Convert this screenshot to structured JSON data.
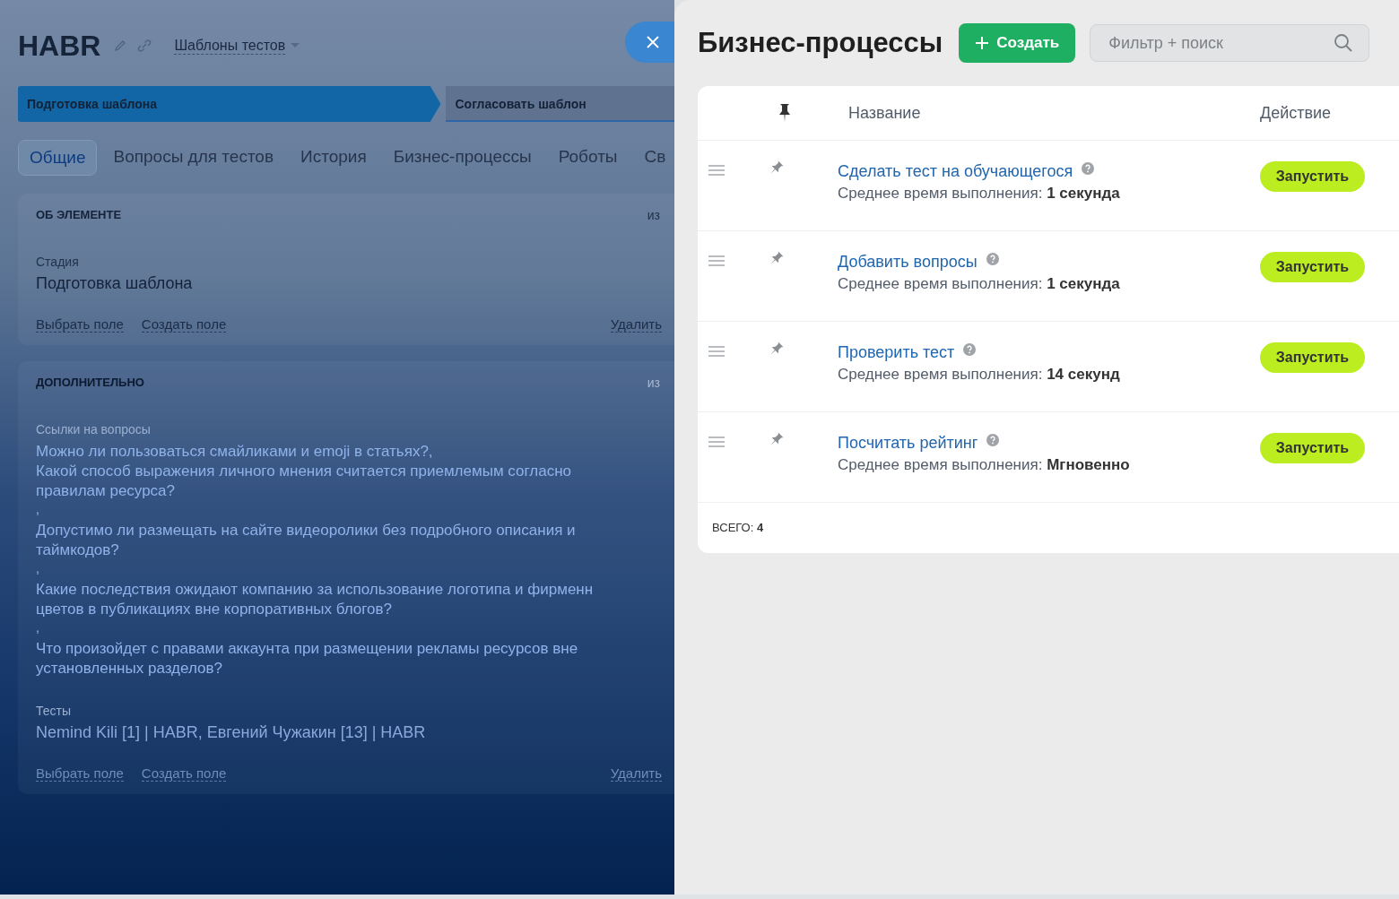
{
  "page": {
    "title": "HABR",
    "category": "Шаблоны тестов",
    "stages": [
      {
        "label": "Подготовка шаблона",
        "selected": true
      },
      {
        "label": "Согласовать шаблон",
        "selected": false
      }
    ],
    "tabs": [
      {
        "label": "Общие",
        "selected": true
      },
      {
        "label": "Вопросы для тестов",
        "selected": false
      },
      {
        "label": "История",
        "selected": false
      },
      {
        "label": "Бизнес-процессы",
        "selected": false
      },
      {
        "label": "Роботы",
        "selected": false
      },
      {
        "label": "Св",
        "selected": false
      }
    ],
    "sections": [
      {
        "title": "ОБ ЭЛЕМЕНТЕ",
        "corner": "из",
        "fields": [
          {
            "kind": "text",
            "label": "Стадия",
            "value": "Подготовка шаблона"
          }
        ],
        "actions": [
          "Выбрать поле",
          "Создать поле"
        ],
        "delete": "Удалить"
      },
      {
        "title": "ДОПОЛНИТЕЛЬНО",
        "corner": "из",
        "fields": [
          {
            "kind": "links",
            "label": "Ссылки на вопросы",
            "links": [
              {
                "lines": [
                  "Можно ли пользоваться смайликами и emoji в статьях?,"
                ]
              },
              {
                "lines": [
                  "Какой способ выражения личного мнения считается приемлемым согласно",
                  "правилам ресурса?"
                ],
                "separator": ","
              },
              {
                "lines": [
                  "Допустимо ли размещать на сайте видеоролики без подробного описания и",
                  "таймкодов?"
                ],
                "separator": ","
              },
              {
                "lines": [
                  "Какие последствия ожидают компанию за использование логотипа и фирменн",
                  "цветов в публикациях вне корпоративных блогов?"
                ],
                "separator": ","
              },
              {
                "lines": [
                  "Что произойдет с правами аккаунта при размещении рекламы ресурсов вне",
                  "установленных разделов?"
                ]
              }
            ]
          },
          {
            "kind": "text",
            "label": "Тесты",
            "value": "Nemind Kili [1] | HABR, Евгений Чужакин [13] | HABR"
          }
        ],
        "actions": [
          "Выбрать поле",
          "Создать поле"
        ],
        "delete": "Удалить"
      }
    ]
  },
  "panel": {
    "title": "Бизнес-процессы",
    "create_button": "Создать",
    "search": {
      "placeholder": "Фильтр + поиск"
    },
    "columns": [
      "Название",
      "Действие"
    ],
    "rows": [
      {
        "name": "Сделать тест на обучающегося",
        "time_label": "Среднее время выполнения:",
        "time": "1 секунда",
        "action": "Запустить"
      },
      {
        "name": "Добавить вопросы",
        "time_label": "Среднее время выполнения:",
        "time": "1 секунда",
        "action": "Запустить"
      },
      {
        "name": "Проверить тест",
        "time_label": "Среднее время выполнения:",
        "time": "14 секунд",
        "action": "Запустить"
      },
      {
        "name": "Посчитать рейтинг",
        "time_label": "Среднее время выполнения:",
        "time": "Мгновенно",
        "action": "Запустить"
      }
    ],
    "total_label": "ВСЕГО:",
    "total": "4"
  }
}
